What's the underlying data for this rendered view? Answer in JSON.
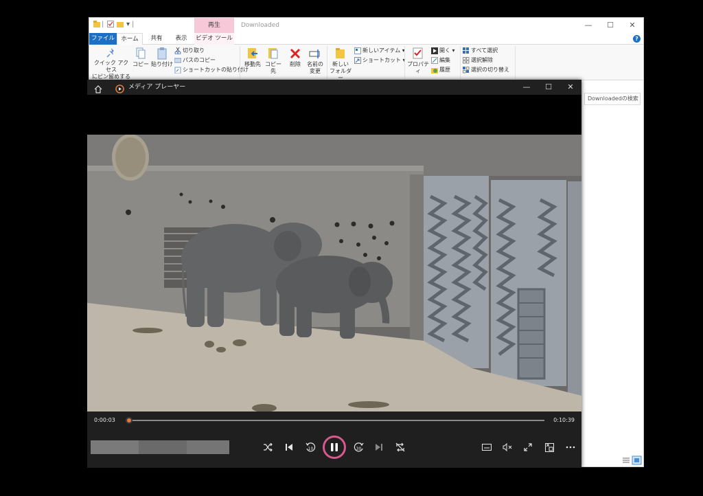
{
  "explorer": {
    "title": "Downloaded",
    "context_tab_group": "再生",
    "tabs": {
      "file": "ファイル",
      "home": "ホーム",
      "share": "共有",
      "view": "表示",
      "video_tools": "ビデオ ツール"
    },
    "window_controls": {
      "minimize": "—",
      "maximize": "☐",
      "close": "✕"
    },
    "help": "?",
    "ribbon": {
      "pin_quick_access": [
        "クイック アクセス",
        "にピン留めする"
      ],
      "copy": "コピー",
      "paste": "貼り付け",
      "cut": "切り取り",
      "copy_path": "パスのコピー",
      "paste_shortcut": "ショートカットの貼り付け",
      "move_to": "移動先",
      "copy_to": "コピー先",
      "delete": "削除",
      "rename": [
        "名前の",
        "変更"
      ],
      "new_folder": [
        "新しい",
        "フォルダー"
      ],
      "new_item": "新しいアイテム",
      "shortcut": "ショートカット",
      "properties": "プロパティ",
      "open": "開く",
      "edit": "編集",
      "history": "履歴",
      "select_all": "すべて選択",
      "select_none": "選択解除",
      "invert_selection": "選択の切り替え"
    },
    "search_placeholder": "Downloadedの検索"
  },
  "player": {
    "title": "メディア プレーヤー",
    "window_controls": {
      "minimize": "—",
      "maximize": "☐",
      "close": "✕"
    },
    "time_current": "0:00:03",
    "time_total": "0:10:39",
    "progress": 0.005,
    "state": "playing",
    "colors": {
      "accent": "#e07a3e",
      "play_ring": "#d85a8c"
    },
    "controls": [
      "shuffle-icon",
      "previous-icon",
      "skip-back-10-icon",
      "pause-icon",
      "skip-forward-30-icon",
      "next-icon",
      "repeat-icon",
      "subtitles-icon",
      "mute-icon",
      "fullscreen-icon",
      "miniplayer-icon",
      "more-icon"
    ]
  }
}
